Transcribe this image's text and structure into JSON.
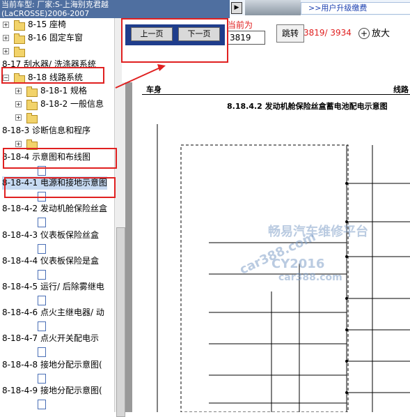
{
  "topbar": {
    "line1": "当前车型:  厂家:S-上海别克君越",
    "line2": "(LaCROSSE)2006-2007"
  },
  "banner": {
    "upgrade_link": ">>用户升级缴费"
  },
  "toolbar": {
    "prev_label": "上一页",
    "next_label": "下一页",
    "current_label": "当前为",
    "page_value": "3819",
    "jump_label": "跳转",
    "page_count": "3819/ 3934",
    "zoom_label": "放大"
  },
  "tree": [
    {
      "label": "8-15 座椅",
      "type": "folder"
    },
    {
      "label": "8-16 固定车窗",
      "type": "folder"
    },
    {
      "label": "",
      "type": "folder"
    },
    {
      "label": "8-17 刮水器/ 洗涤器系统",
      "type": "text"
    },
    {
      "label": "8-18 线路系统",
      "type": "folder-open"
    },
    {
      "label": "8-18-1 规格",
      "type": "folder"
    },
    {
      "label": "8-18-2 一般信息",
      "type": "folder"
    },
    {
      "label": "",
      "type": "folder"
    },
    {
      "label": "8-18-3 诊断信息和程序",
      "type": "text"
    },
    {
      "label": "",
      "type": "folder"
    },
    {
      "label": "8-18-4 示意图和布线图",
      "type": "text"
    },
    {
      "label": "",
      "type": "doc"
    },
    {
      "label": "8-18-4-1 电源和接地示意图",
      "type": "text-selected"
    },
    {
      "label": "",
      "type": "doc"
    },
    {
      "label": "8-18-4-2 发动机舱保险丝盒",
      "type": "text"
    },
    {
      "label": "",
      "type": "doc"
    },
    {
      "label": "8-18-4-3 仪表板保险丝盒",
      "type": "text"
    },
    {
      "label": "",
      "type": "doc"
    },
    {
      "label": "8-18-4-4 仪表板保险是盒",
      "type": "text"
    },
    {
      "label": "",
      "type": "doc"
    },
    {
      "label": "8-18-4-5 运行/ 后除雾继电",
      "type": "text"
    },
    {
      "label": "",
      "type": "doc"
    },
    {
      "label": "8-18-4-6 点火主继电器/ 动",
      "type": "text"
    },
    {
      "label": "",
      "type": "doc"
    },
    {
      "label": "8-18-4-7 点火开关配电示",
      "type": "text"
    },
    {
      "label": "",
      "type": "doc"
    },
    {
      "label": "8-18-4-8 接地分配示意图(",
      "type": "text"
    },
    {
      "label": "",
      "type": "doc"
    },
    {
      "label": "8-18-4-9 接地分配示意图(",
      "type": "text"
    },
    {
      "label": "",
      "type": "doc"
    }
  ],
  "document": {
    "header_left": "车身",
    "header_right": "线路",
    "title": "8.18.4.2 发动机舱保险丝盒蓄电池配电示意图",
    "watermarks": [
      "畅易汽车维修平台",
      "car388.com",
      "CY2016",
      "car388.com"
    ]
  },
  "colors": {
    "accent_red": "#e02020",
    "nav_blue": "#1f3d8c",
    "selection": "#c7daf2"
  }
}
